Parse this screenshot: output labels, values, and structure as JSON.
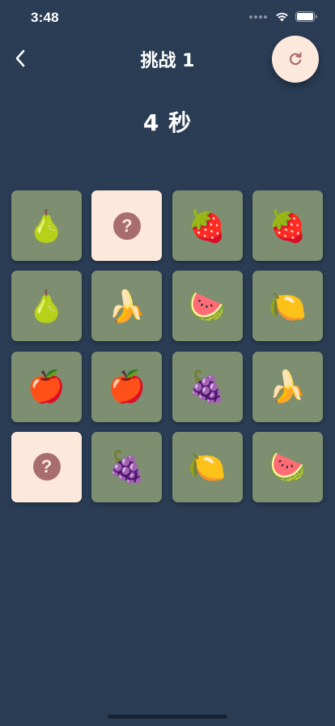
{
  "status_bar": {
    "time": "3:48"
  },
  "header": {
    "title": "挑战 1",
    "back_icon": "chevron-left-icon",
    "reset_icon": "refresh-icon"
  },
  "timer": {
    "text": "4 秒"
  },
  "colors": {
    "background": "#2a3d55",
    "card_face_up": "#7d8f70",
    "card_face_down": "#fde9dc",
    "question_badge": "#a86e6e",
    "reset_button": "#fde9dc",
    "reset_icon": "#a86e6e"
  },
  "board": {
    "columns": 4,
    "rows": 4,
    "cards": [
      {
        "state": "up",
        "fruit": "pear",
        "glyph": "🍐"
      },
      {
        "state": "down",
        "fruit": "hidden",
        "glyph": "?"
      },
      {
        "state": "up",
        "fruit": "strawberry",
        "glyph": "🍓"
      },
      {
        "state": "up",
        "fruit": "strawberry",
        "glyph": "🍓"
      },
      {
        "state": "up",
        "fruit": "pear",
        "glyph": "🍐"
      },
      {
        "state": "up",
        "fruit": "banana",
        "glyph": "🍌"
      },
      {
        "state": "up",
        "fruit": "watermelon",
        "glyph": "🍉"
      },
      {
        "state": "up",
        "fruit": "lemon",
        "glyph": "🍋"
      },
      {
        "state": "up",
        "fruit": "apple",
        "glyph": "🍎"
      },
      {
        "state": "up",
        "fruit": "apple",
        "glyph": "🍎"
      },
      {
        "state": "up",
        "fruit": "grapes",
        "glyph": "🍇"
      },
      {
        "state": "up",
        "fruit": "banana",
        "glyph": "🍌"
      },
      {
        "state": "down",
        "fruit": "hidden",
        "glyph": "?"
      },
      {
        "state": "up",
        "fruit": "grapes",
        "glyph": "🍇"
      },
      {
        "state": "up",
        "fruit": "lemon",
        "glyph": "🍋"
      },
      {
        "state": "up",
        "fruit": "watermelon",
        "glyph": "🍉"
      }
    ]
  }
}
